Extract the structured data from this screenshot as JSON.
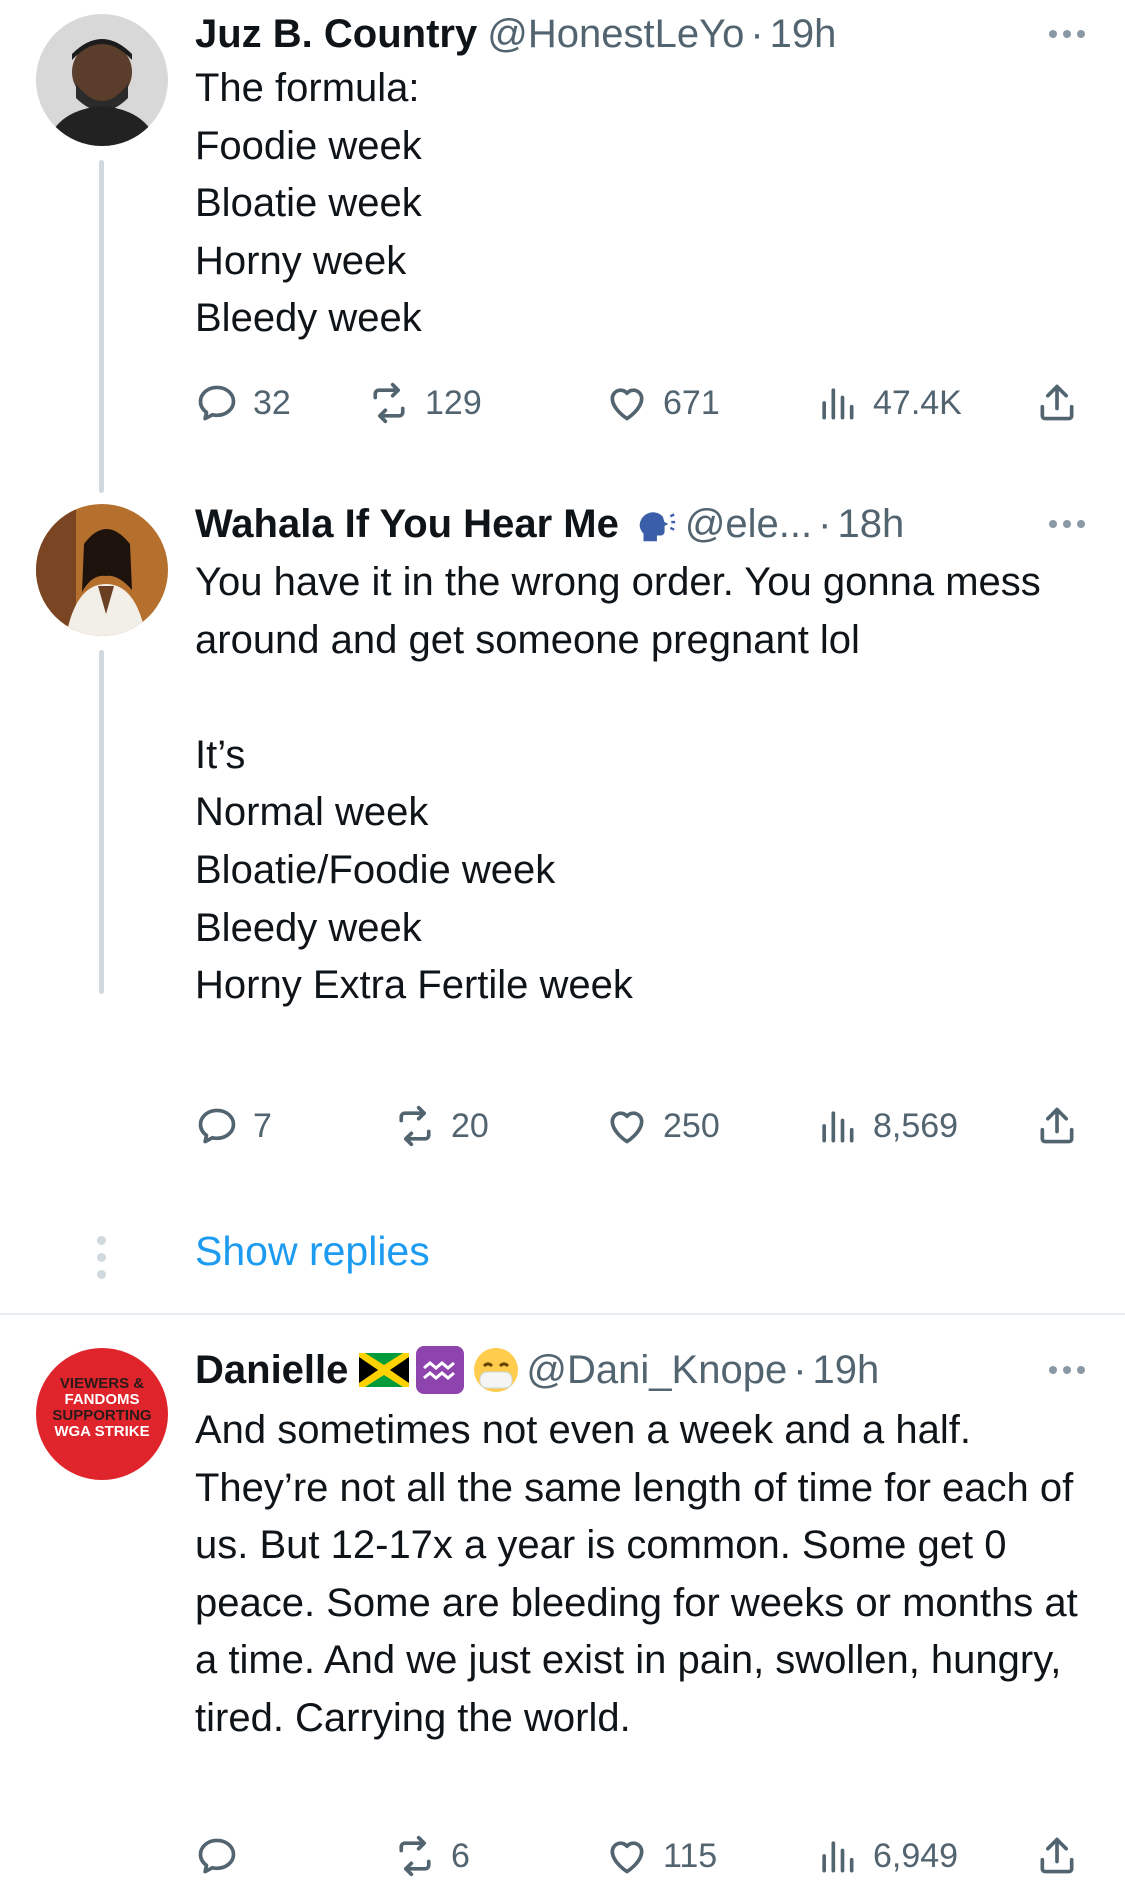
{
  "tweets": [
    {
      "name": "Juz B. Country",
      "handle": "@HonestLeYo",
      "time": "19h",
      "text": "The formula:\nFoodie week\nBloatie week\nHorny week\nBleedy week",
      "replies": "32",
      "retweets": "129",
      "likes": "671",
      "views": "47.4K"
    },
    {
      "name": "Wahala If You Hear Me",
      "handle": "@ele...",
      "time": "18h",
      "name_icon": "speaking-head-icon",
      "text": "You have it in the wrong order. You gonna mess around and get someone pregnant lol\n\nIt’s\nNormal week\nBloatie/Foodie week\nBleedy week\nHorny Extra Fertile week",
      "replies": "7",
      "retweets": "20",
      "likes": "250",
      "views": "8,569"
    },
    {
      "name": "Danielle",
      "handle": "@Dani_Knope",
      "time": "19h",
      "name_icons": [
        "jamaica-flag-icon",
        "aquarius-icon",
        "face-with-mask-icon"
      ],
      "avatar_text": [
        "VIEWERS &",
        "FANDOMS",
        "SUPPORTING",
        "WGA STRIKE"
      ],
      "text": "And sometimes not even a week and a half. They’re not all the same length of time for each of us. But 12-17x a year is common. Some get 0 peace. Some are bleeding for weeks or months at a time. And we just exist in pain, swollen, hungry, tired. Carrying the world.",
      "replies": "",
      "retweets": "6",
      "likes": "115",
      "views": "6,949"
    }
  ],
  "show_replies": "Show replies",
  "colors": {
    "link": "#1d9bf0",
    "secondary": "#536471",
    "thread_line": "#cfd9de",
    "danielle_avatar_bg": "#e0242b"
  }
}
